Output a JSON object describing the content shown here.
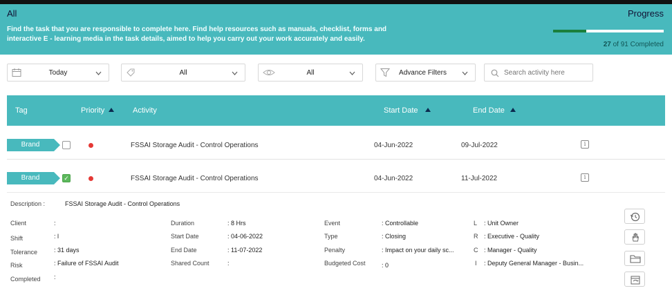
{
  "banner": {
    "title": "All",
    "description": "Find the task that you are responsible to complete here. Find help resources such as manuals, checklist, forms and interactive E - learning media in the task details, aimed to help you carry out your work accurately and easily.",
    "progress_title": "Progress",
    "completed_count": "27",
    "completed_suffix": " of 91 Completed",
    "progress_fraction": 0.297,
    "accent": "#48b9bd"
  },
  "filters": {
    "date": {
      "value": "Today",
      "icon": "calendar-icon"
    },
    "tag": {
      "value": "All",
      "icon": "tag-icon"
    },
    "view": {
      "value": "All",
      "icon": "eye-icon"
    },
    "advance": {
      "value": "Advance Filters",
      "icon": "filter-icon"
    },
    "search": {
      "placeholder": "Search activity here",
      "icon": "search-icon"
    }
  },
  "table": {
    "headers": {
      "tag": "Tag",
      "priority": "Priority",
      "activity": "Activity",
      "start": "Start Date",
      "end": "End Date"
    },
    "rows": [
      {
        "tag": "Brand",
        "checked": false,
        "activity": "FSSAI Storage Audit - Control Operations",
        "start": "04-Jun-2022",
        "end": "09-Jul-2022"
      },
      {
        "tag": "Brand",
        "checked": true,
        "activity": "FSSAI Storage Audit - Control Operations",
        "start": "04-Jun-2022",
        "end": "11-Jul-2022"
      }
    ]
  },
  "details": {
    "description_label": "Description :",
    "description": "FSSAI Storage Audit - Control Operations",
    "col1": [
      {
        "label": "Client",
        "value": ":"
      },
      {
        "label": "Shift",
        "value": ": l"
      },
      {
        "label": "Tolerance",
        "value": ": 31 days"
      },
      {
        "label": "Risk",
        "value": ": Failure of FSSAI Audit"
      },
      {
        "label": "Completed",
        "value": ":"
      }
    ],
    "col2": [
      {
        "label": "Duration",
        "value": ": 8 Hrs"
      },
      {
        "label": "Start Date",
        "value": ": 04-06-2022"
      },
      {
        "label": "End Date",
        "value": ": 11-07-2022"
      },
      {
        "label": "Shared Count",
        "value": ":"
      }
    ],
    "col3": [
      {
        "label": "Event",
        "value": ": Controllable"
      },
      {
        "label": "Type",
        "value": ": Closing"
      },
      {
        "label": "Penalty",
        "value": ": Impact on your daily sc..."
      },
      {
        "label": "Budgeted Cost",
        "value": ": 0"
      }
    ],
    "col4": [
      {
        "label": "L",
        "value": ": Unit Owner"
      },
      {
        "label": "R",
        "value": ": Executive - Quality"
      },
      {
        "label": "C",
        "value": ": Manager - Quality"
      },
      {
        "label": "I",
        "value": ": Deputy General Manager - Busin..."
      }
    ]
  },
  "side_buttons": [
    "history-icon",
    "hand-icon",
    "folder-icon",
    "refresh-calendar-icon"
  ]
}
